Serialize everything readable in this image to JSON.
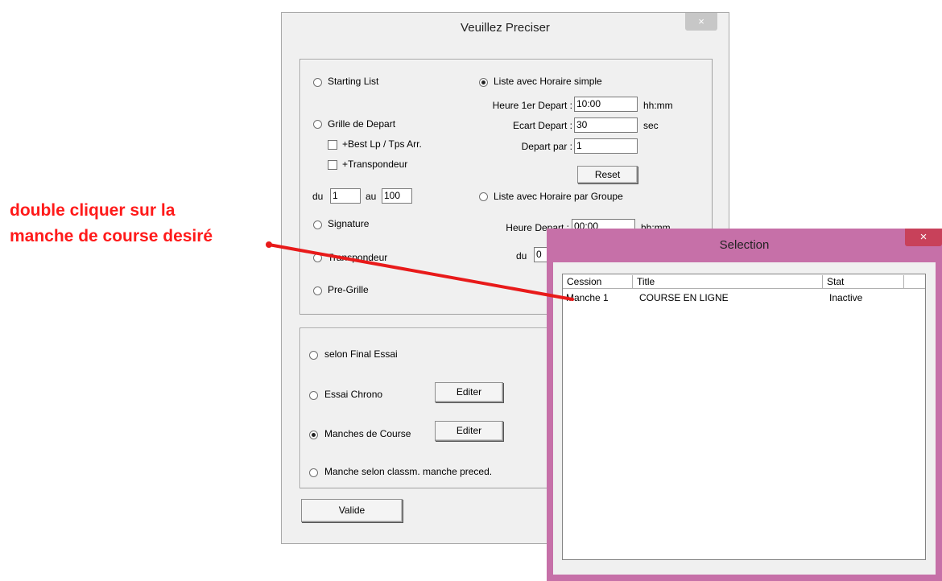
{
  "main_dialog": {
    "title": "Veuillez Preciser",
    "close": "×",
    "group1": {
      "starting_list": "Starting List",
      "grille_depart": "Grille de Depart",
      "best_lp": "+Best Lp / Tps Arr.",
      "transpondeur_chk": "+Transpondeur",
      "du": "du",
      "du_value": "1",
      "au": "au",
      "au_value": "100",
      "signature": "Signature",
      "transpondeur": "Transpondeur",
      "pre_grille": "Pre-Grille",
      "liste_simple": "Liste avec Horaire simple",
      "heure_1er_depart": "Heure 1er Depart :",
      "heure_1er_value": "10:00",
      "hhmm1": "hh:mm",
      "ecart_depart": "Ecart Depart :",
      "ecart_value": "30",
      "sec": "sec",
      "depart_par": "Depart par :",
      "depart_par_value": "1",
      "reset": "Reset",
      "liste_groupe": "Liste avec Horaire par Groupe",
      "heure_depart": "Heure Depart :",
      "heure_depart_value": "00:00",
      "hhmm2": "hh:mm",
      "du2": "du",
      "du2_value": "0"
    },
    "group2": {
      "selon_final": "selon Final Essai",
      "essai_chrono": "Essai Chrono",
      "editer1": "Editer",
      "manches_course": "Manches de Course",
      "editer2": "Editer",
      "manche_selon": "Manche selon classm. manche preced."
    },
    "valide": "Valide"
  },
  "selection_dialog": {
    "title": "Selection",
    "close": "×",
    "columns": [
      "Cession",
      "Title",
      "Stat"
    ],
    "rows": [
      {
        "cession": "Manche 1",
        "title": "COURSE EN LIGNE",
        "stat": "Inactive"
      }
    ]
  },
  "annotation": {
    "line1": "double cliquer sur la",
    "line2": "manche de course desiré",
    "color": "#ff1a1a"
  }
}
